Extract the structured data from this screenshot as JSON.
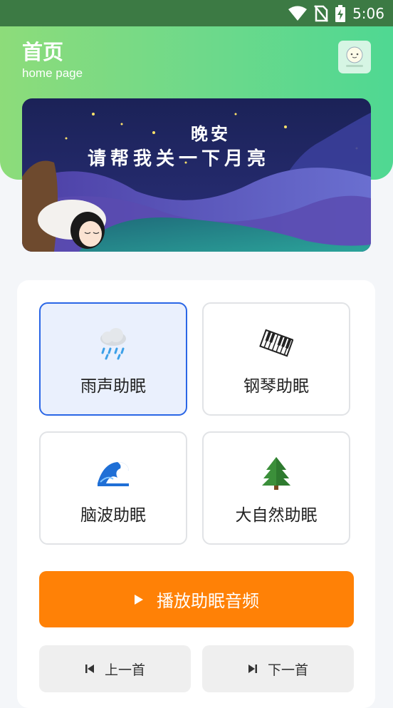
{
  "status_bar": {
    "time": "5:06",
    "icons": [
      "wifi-icon",
      "no-sim-icon",
      "battery-charging-icon"
    ]
  },
  "header": {
    "title": "首页",
    "subtitle": "home page",
    "logo_icon": "app-logo-icon"
  },
  "banner": {
    "line1": "晚安",
    "line2": "请帮我关一下月亮"
  },
  "sound_options": [
    {
      "label": "雨声助眠",
      "icon": "rain-cloud-icon",
      "selected": true
    },
    {
      "label": "钢琴助眠",
      "icon": "piano-keys-icon",
      "selected": false
    },
    {
      "label": "脑波助眠",
      "icon": "wave-icon",
      "selected": false
    },
    {
      "label": "大自然助眠",
      "icon": "tree-icon",
      "selected": false
    }
  ],
  "controls": {
    "play_label": "播放助眠音频",
    "prev_label": "上一首",
    "next_label": "下一首"
  },
  "colors": {
    "header_green": "#6fd98a",
    "selected_border": "#2a66e6",
    "play_orange": "#ff8106"
  }
}
